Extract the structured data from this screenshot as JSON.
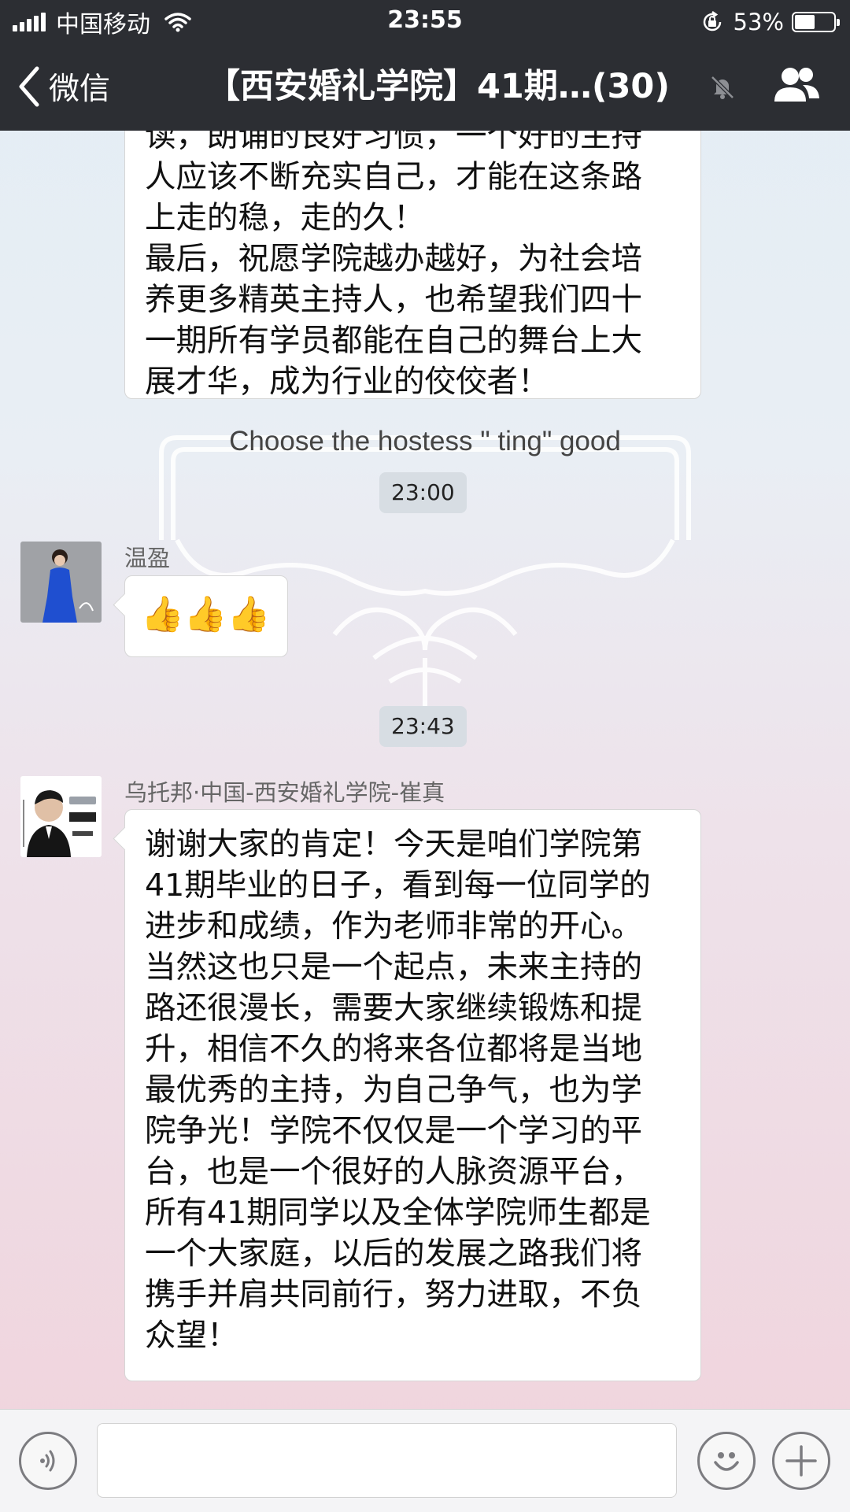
{
  "status_bar": {
    "carrier": "中国移动",
    "time": "23:55",
    "battery_percent": "53%",
    "battery_level": 0.53,
    "icons": [
      "signal-icon",
      "wifi-icon",
      "orientation-lock-icon",
      "battery-icon"
    ]
  },
  "nav": {
    "back_label": "微信",
    "title": "【西安婚礼学院】41期…(30)",
    "icons": [
      "back-chevron-icon",
      "mute-bell-icon",
      "group-members-icon"
    ]
  },
  "chat": {
    "messages": [
      {
        "type": "text",
        "lines": [
          "读，朗诵的良好习惯，一个好的主持",
          "人应该不断充实自己，才能在这条路",
          "上走的稳，走的久！",
          "最后，祝愿学院越办越好，为社会培",
          "养更多精英主持人，也希望我们四十",
          "一期所有学员都能在自己的舞台上大",
          "展才华，成为行业的佼佼者！"
        ]
      },
      {
        "type": "timestamp",
        "text": "23:00"
      },
      {
        "type": "text",
        "sender": "温盈",
        "content": "👍👍👍"
      },
      {
        "type": "timestamp",
        "text": "23:43"
      },
      {
        "type": "text",
        "sender": "乌托邦·中国-西安婚礼学院-崔真",
        "lines": [
          "谢谢大家的肯定！今天是咱们学院第",
          "41期毕业的日子，看到每一位同学的",
          "进步和成绩，作为老师非常的开心。",
          "当然这也只是一个起点，未来主持的",
          "路还很漫长，需要大家继续锻炼和提",
          "升，相信不久的将来各位都将是当地",
          "最优秀的主持，为自己争气，也为学",
          "院争光！学院不仅仅是一个学习的平",
          "台，也是一个很好的人脉资源平台，",
          "所有41期同学以及全体学院师生都是",
          "一个大家庭，以后的发展之路我们将",
          "携手并肩共同前行，努力进取，不负",
          "众望！"
        ]
      }
    ],
    "background_caption": "Choose the hostess \" ting\" good"
  },
  "input_bar": {
    "icons": [
      "voice-icon",
      "emoji-icon",
      "plus-icon"
    ]
  },
  "colors": {
    "header": "#2c2e33",
    "bubble": "#ffffff",
    "timestamp_chip": "#d7dde3"
  }
}
